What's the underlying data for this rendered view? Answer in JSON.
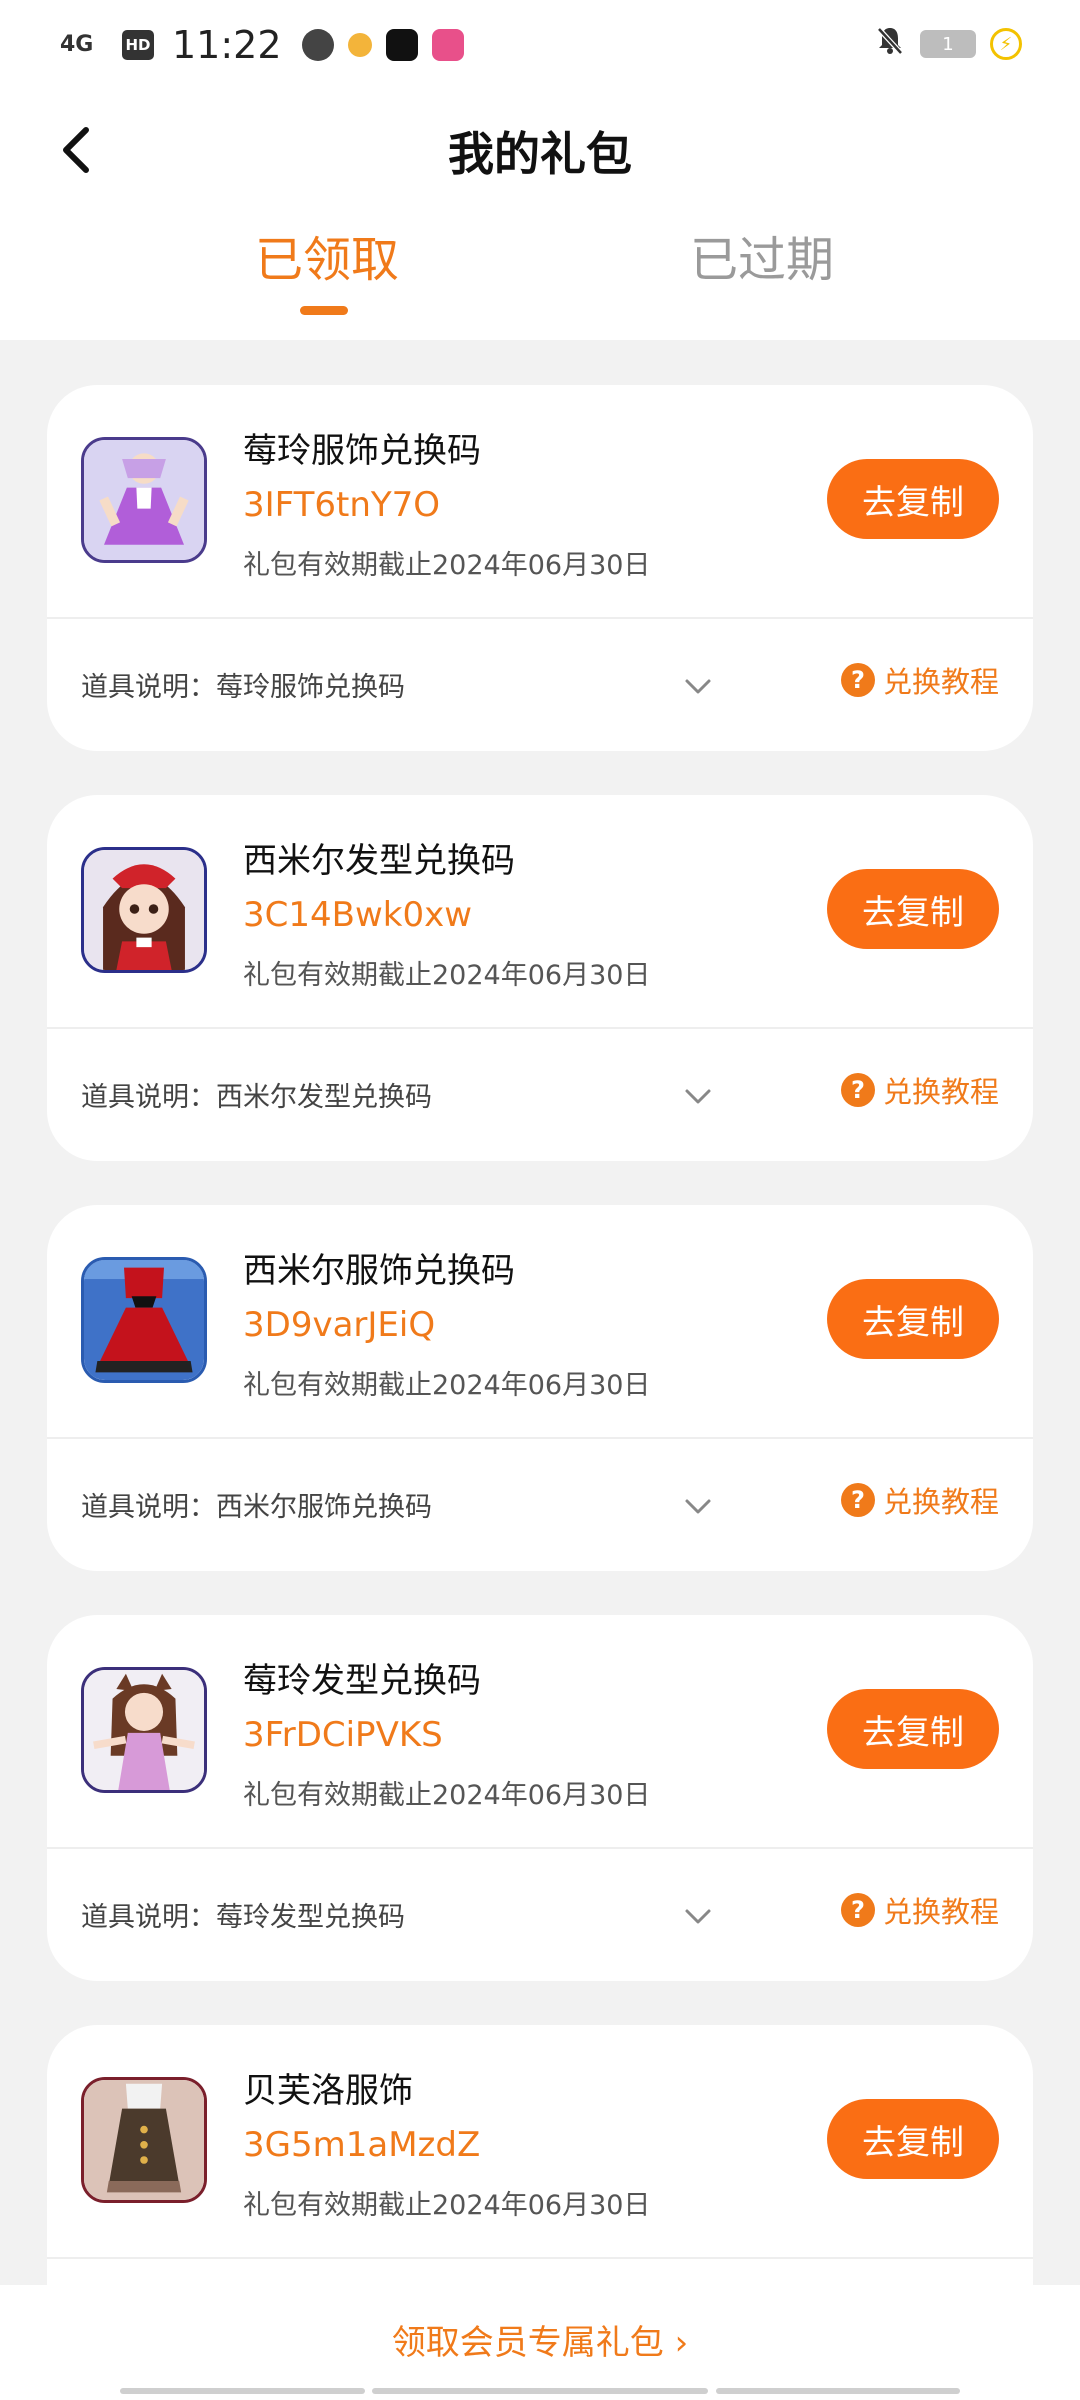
{
  "status_bar": {
    "network": "4G",
    "hd": "HD",
    "time": "11:22",
    "battery": "1"
  },
  "header": {
    "title": "我的礼包",
    "back_icon": "chevron-left-icon"
  },
  "tabs": [
    {
      "label": "已领取",
      "active": true
    },
    {
      "label": "已过期",
      "active": false
    }
  ],
  "gifts": [
    {
      "name": "莓玲服饰兑换码",
      "code": "3IFT6tnY7O",
      "expiry": "礼包有效期截止2024年06月30日",
      "copy_label": "去复制",
      "desc_prefix": "道具说明：",
      "desc": "莓玲服饰兑换码",
      "tutorial": "兑换教程",
      "thumb": "purple-dress-character"
    },
    {
      "name": "西米尔发型兑换码",
      "code": "3C14Bwk0xw",
      "expiry": "礼包有效期截止2024年06月30日",
      "copy_label": "去复制",
      "desc_prefix": "道具说明：",
      "desc": "西米尔发型兑换码",
      "tutorial": "兑换教程",
      "thumb": "red-hat-character"
    },
    {
      "name": "西米尔服饰兑换码",
      "code": "3D9varJEiQ",
      "expiry": "礼包有效期截止2024年06月30日",
      "copy_label": "去复制",
      "desc_prefix": "道具说明：",
      "desc": "西米尔服饰兑换码",
      "tutorial": "兑换教程",
      "thumb": "red-dress"
    },
    {
      "name": "莓玲发型兑换码",
      "code": "3FrDCiPVKS",
      "expiry": "礼包有效期截止2024年06月30日",
      "copy_label": "去复制",
      "desc_prefix": "道具说明：",
      "desc": "莓玲发型兑换码",
      "tutorial": "兑换教程",
      "thumb": "cat-ear-character"
    },
    {
      "name": "贝芙洛服饰",
      "code": "3G5m1aMzdZ",
      "expiry": "礼包有效期截止2024年06月30日",
      "copy_label": "去复制",
      "thumb": "brown-outfit-character"
    }
  ],
  "footer": {
    "vip_link": "领取会员专属礼包 ›"
  },
  "colors": {
    "accent": "#f07a1a",
    "button": "#fa6e14",
    "background": "#f2f2f2"
  }
}
